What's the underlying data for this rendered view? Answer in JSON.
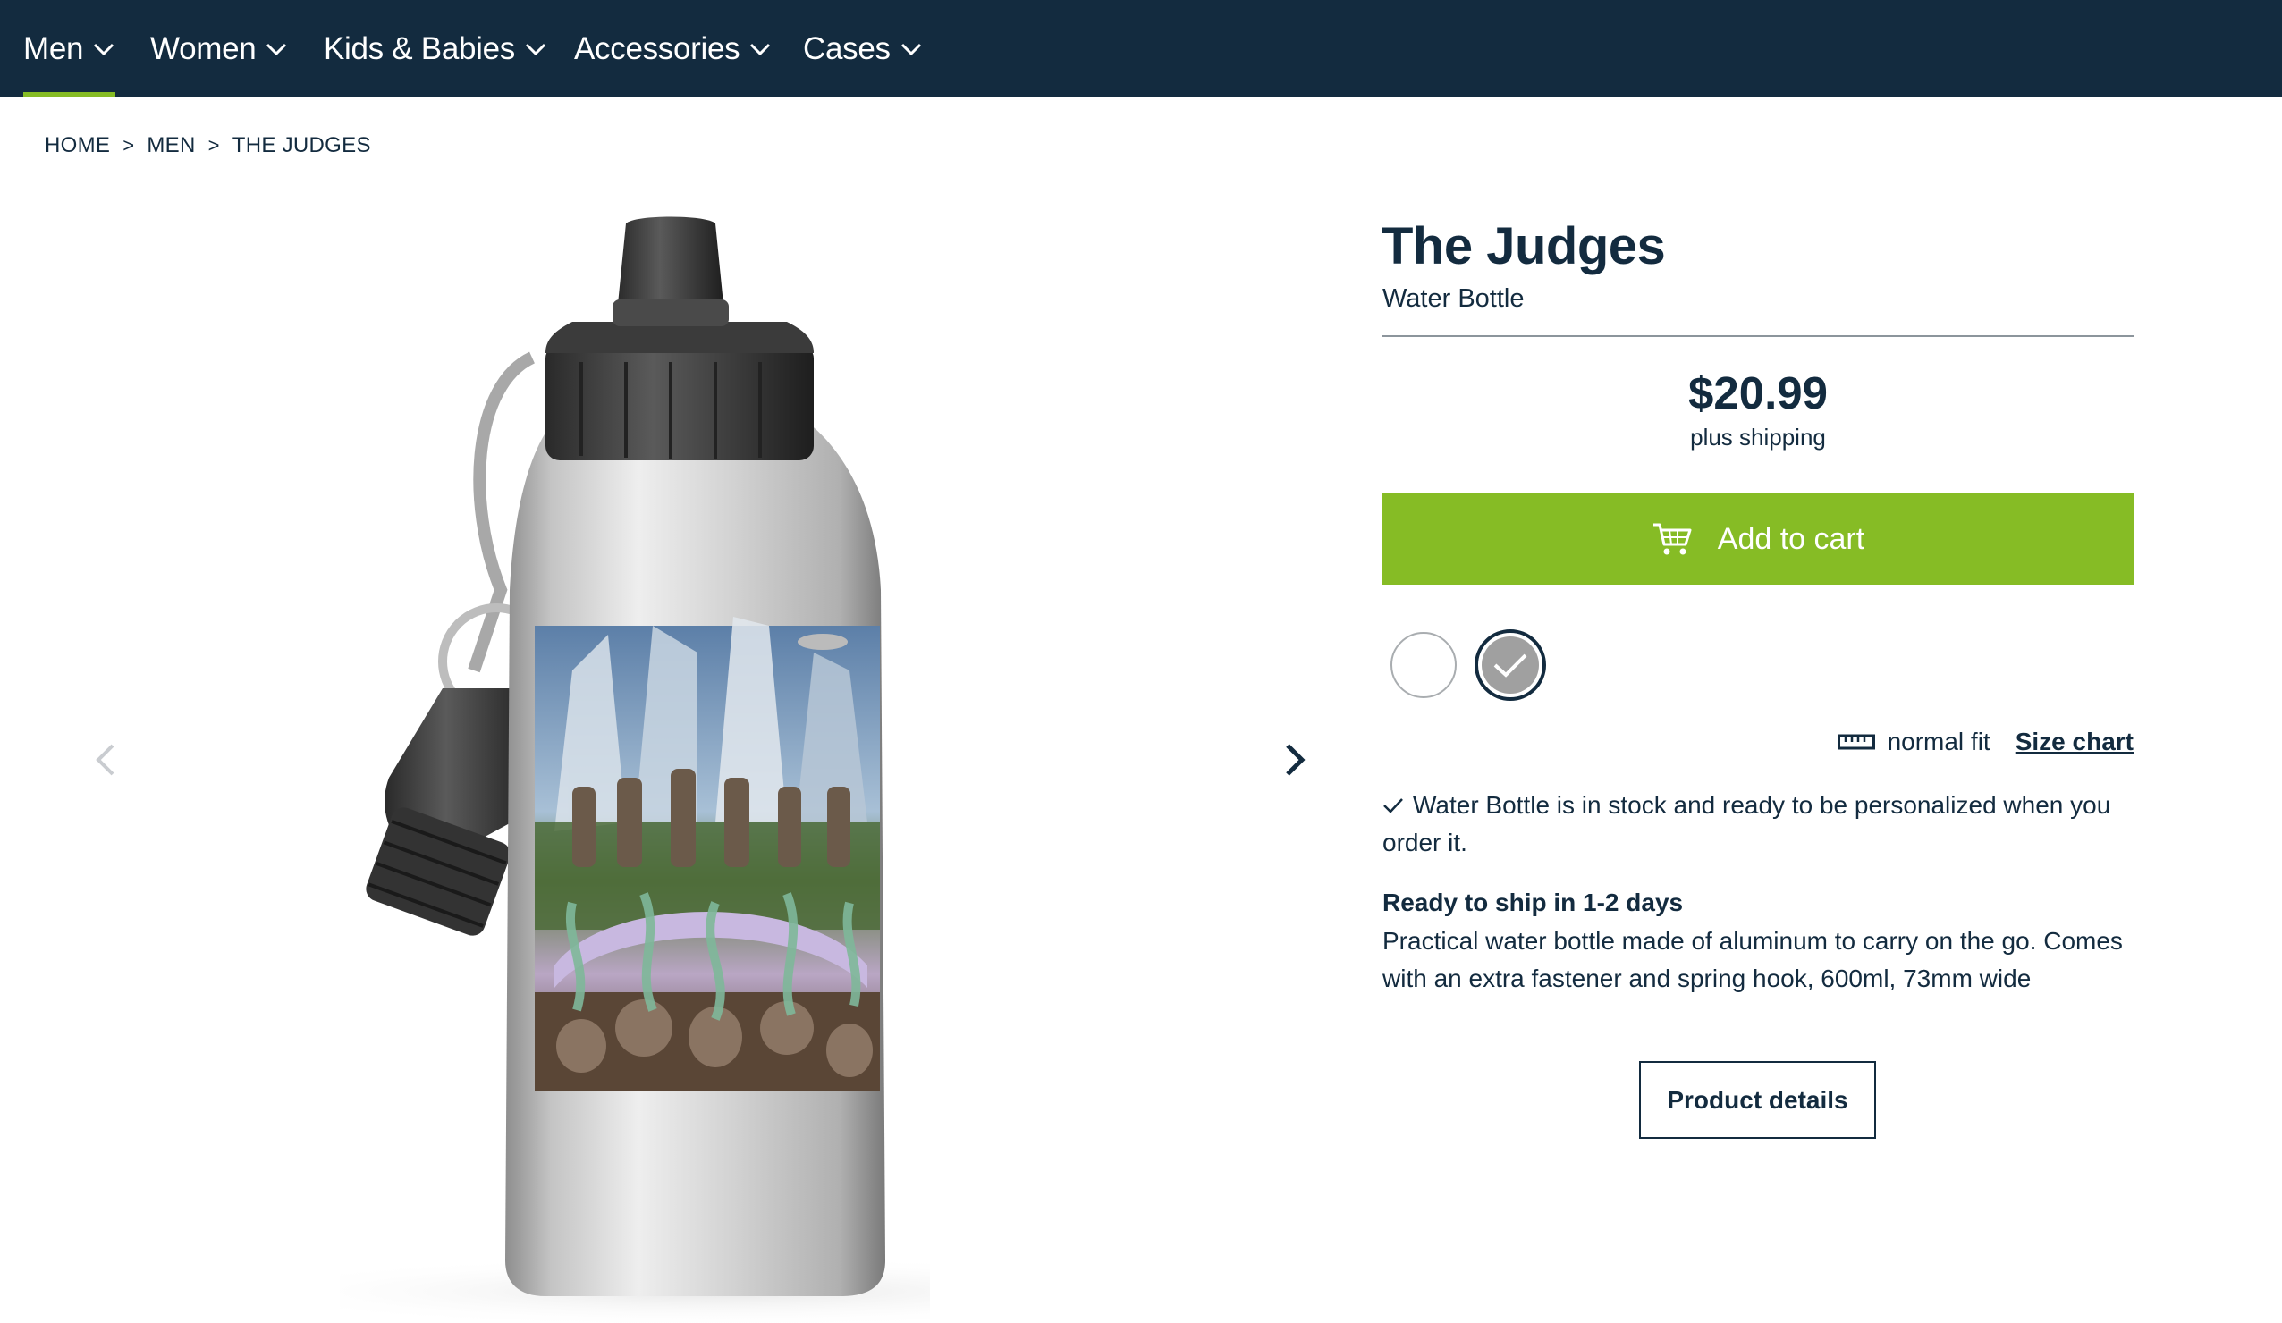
{
  "nav": {
    "items": [
      {
        "label": "Men"
      },
      {
        "label": "Women"
      },
      {
        "label": "Kids & Babies"
      },
      {
        "label": "Accessories"
      },
      {
        "label": "Cases"
      }
    ],
    "active_index": 0
  },
  "breadcrumb": [
    "HOME",
    "MEN",
    "THE JUDGES"
  ],
  "breadcrumb_separator": ">",
  "product": {
    "title": "The Judges",
    "type": "Water Bottle",
    "price": "$20.99",
    "shipping_note": "plus shipping",
    "add_to_cart_label": "Add to cart",
    "colors": [
      {
        "name": "white",
        "hex": "#ffffff",
        "selected": false
      },
      {
        "name": "silver",
        "hex": "#a0a0a0",
        "selected": true
      }
    ],
    "fit": "normal fit",
    "size_chart_label": "Size chart",
    "stock_message": "Water Bottle is in stock and ready to be personalized when you order it.",
    "ship_time": "Ready to ship in 1-2 days",
    "description": "Practical water bottle made of aluminum to carry on the go. Comes with an extra fastener and spring hook, 600ml, 73mm wide",
    "details_button_label": "Product details"
  },
  "colors": {
    "nav_bg": "#132b3f",
    "accent_green": "#86bc25",
    "text_dark": "#132b3f"
  },
  "icons": {
    "cart": "cart-icon",
    "chevron": "chevron-down-icon",
    "ruler": "ruler-icon",
    "check": "check-icon",
    "prev": "chevron-left-icon",
    "next": "chevron-right-icon"
  }
}
